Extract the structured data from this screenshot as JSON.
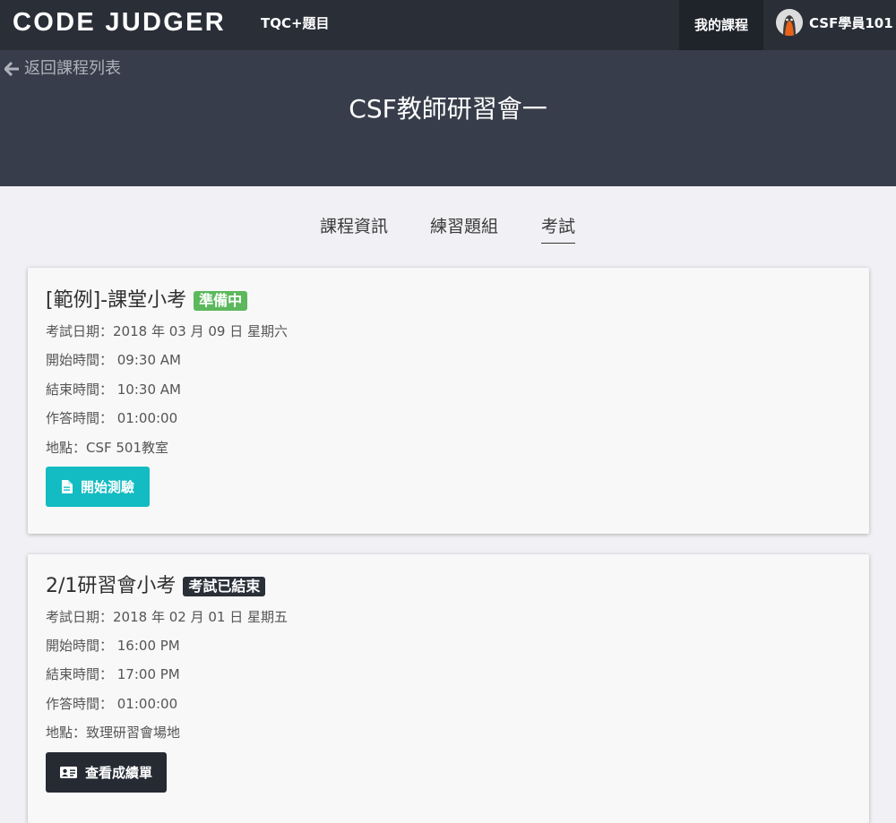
{
  "nav": {
    "logo": "CODE JUDGER",
    "link": "TQC+題目",
    "my_courses": "我的課程",
    "user": "CSF學員101"
  },
  "header": {
    "back": "返回課程列表",
    "title": "CSF教師研習會一"
  },
  "tabs": [
    "課程資訊",
    "練習題組",
    "考試"
  ],
  "active_tab": "考試",
  "exams": [
    {
      "title": "[範例]-課堂小考",
      "status": "準備中",
      "status_color": "#5cb85c",
      "date": "考試日期：2018 年 03 月 09 日 星期六",
      "start": "開始時間：  09:30 AM",
      "end": "結束時間：  10:30 AM",
      "duration": "作答時間：  01:00:00",
      "location": "地點：CSF 501教室",
      "button": "開始測驗",
      "button_color": "#12bcc2",
      "button_icon": "document-icon"
    },
    {
      "title": "2/1研習會小考",
      "status": "考試已結束",
      "status_color": "#2a2f38",
      "date": "考試日期：2018 年 02 月 01 日 星期五",
      "start": "開始時間：  16:00 PM",
      "end": "結束時間：  17:00 PM",
      "duration": "作答時間：  01:00:00",
      "location": "地點：致理研習會場地",
      "button": "查看成績單",
      "button_color": "#252a33",
      "button_icon": "id-card-icon"
    }
  ]
}
